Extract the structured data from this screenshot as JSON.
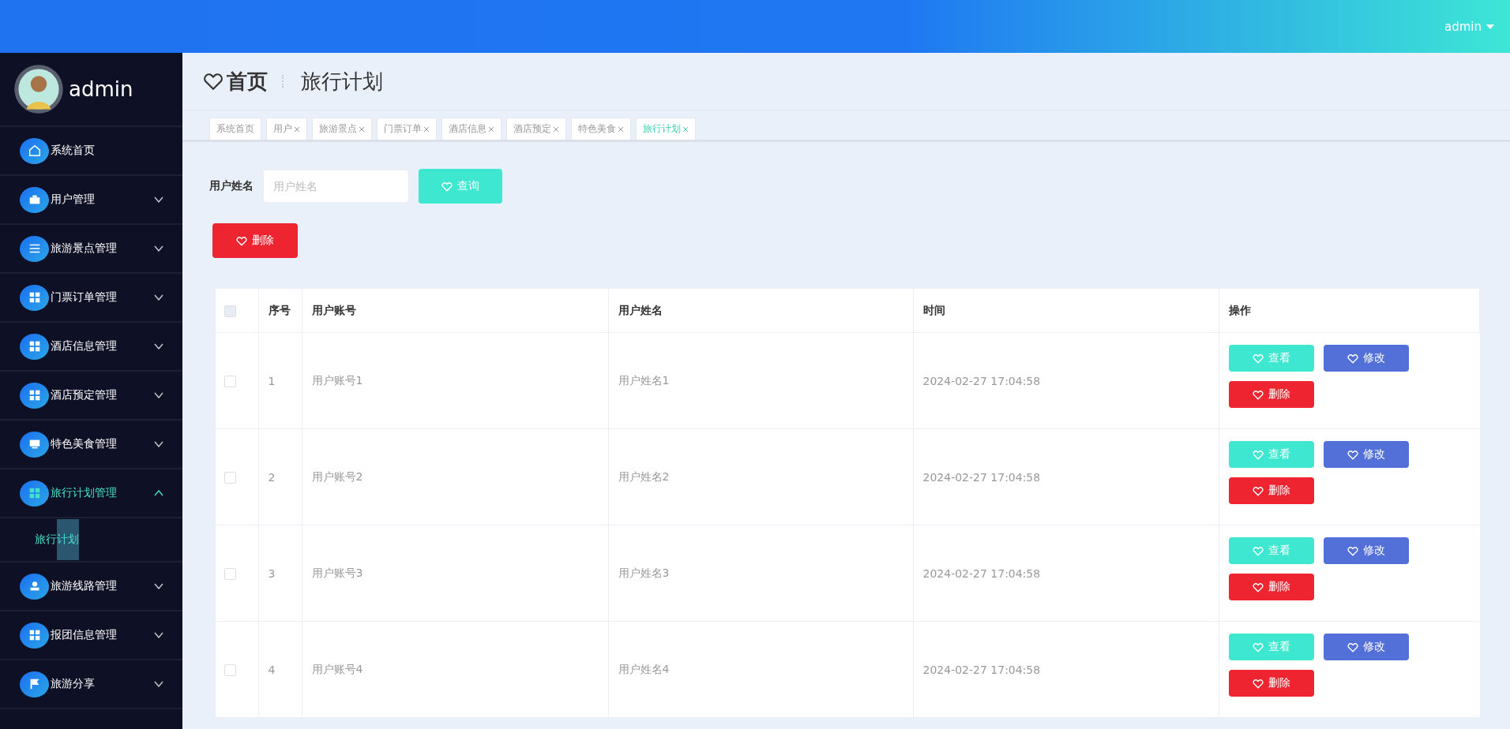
{
  "header": {
    "user": "admin"
  },
  "sidebar": {
    "profile_name": "admin",
    "items": [
      {
        "label": "系统首页",
        "kind": "home",
        "selected": false
      },
      {
        "label": "用户管理",
        "kind": "briefcase",
        "expanded": false,
        "selected": false
      },
      {
        "label": "旅游景点管理",
        "kind": "sliders",
        "expanded": false,
        "selected": false
      },
      {
        "label": "门票订单管理",
        "kind": "grid",
        "expanded": false,
        "selected": false
      },
      {
        "label": "酒店信息管理",
        "kind": "grid",
        "expanded": false,
        "selected": false
      },
      {
        "label": "酒店预定管理",
        "kind": "grid",
        "expanded": false,
        "selected": false
      },
      {
        "label": "特色美食管理",
        "kind": "monitor",
        "expanded": false,
        "selected": false
      },
      {
        "label": "旅行计划管理",
        "kind": "grid",
        "expanded": true,
        "selected": true,
        "children": [
          {
            "label": "旅行计划",
            "selected": true
          }
        ]
      },
      {
        "label": "旅游线路管理",
        "kind": "person",
        "expanded": false,
        "selected": false
      },
      {
        "label": "报团信息管理",
        "kind": "grid",
        "expanded": false,
        "selected": false
      },
      {
        "label": "旅游分享",
        "kind": "flag",
        "expanded": false,
        "selected": false
      }
    ]
  },
  "breadcrumb": {
    "home": "首页",
    "current": "旅行计划"
  },
  "tabs": [
    {
      "label": "系统首页",
      "closable": false,
      "selected": false
    },
    {
      "label": "用户",
      "closable": true,
      "selected": false
    },
    {
      "label": "旅游景点",
      "closable": true,
      "selected": false
    },
    {
      "label": "门票订单",
      "closable": true,
      "selected": false
    },
    {
      "label": "酒店信息",
      "closable": true,
      "selected": false
    },
    {
      "label": "酒店预定",
      "closable": true,
      "selected": false
    },
    {
      "label": "特色美食",
      "closable": true,
      "selected": false
    },
    {
      "label": "旅行计划",
      "closable": true,
      "selected": true
    }
  ],
  "search": {
    "label": "用户姓名",
    "placeholder": "用户姓名",
    "button": "查询"
  },
  "delete_button": "删除",
  "table": {
    "all_checked": false,
    "columns": [
      "序号",
      "用户账号",
      "用户姓名",
      "时间",
      "操作"
    ],
    "rows": [
      {
        "checked": false,
        "cells": [
          "1",
          "用户账号1",
          "用户姓名1",
          "2024-02-27 17:04:58"
        ],
        "actions": [
          {
            "label": "查看",
            "kind": "view"
          },
          {
            "label": "修改",
            "kind": "edit"
          },
          {
            "label": "删除",
            "kind": "delete"
          }
        ]
      },
      {
        "checked": false,
        "cells": [
          "2",
          "用户账号2",
          "用户姓名2",
          "2024-02-27 17:04:58"
        ],
        "actions": [
          {
            "label": "查看",
            "kind": "view"
          },
          {
            "label": "修改",
            "kind": "edit"
          },
          {
            "label": "删除",
            "kind": "delete"
          }
        ]
      },
      {
        "checked": false,
        "cells": [
          "3",
          "用户账号3",
          "用户姓名3",
          "2024-02-27 17:04:58"
        ],
        "actions": [
          {
            "label": "查看",
            "kind": "view"
          },
          {
            "label": "修改",
            "kind": "edit"
          },
          {
            "label": "删除",
            "kind": "delete"
          }
        ]
      },
      {
        "checked": false,
        "cells": [
          "4",
          "用户账号4",
          "用户姓名4",
          "2024-02-27 17:04:58"
        ],
        "actions": [
          {
            "label": "查看",
            "kind": "view"
          },
          {
            "label": "修改",
            "kind": "edit"
          },
          {
            "label": "删除",
            "kind": "delete"
          }
        ]
      }
    ]
  }
}
